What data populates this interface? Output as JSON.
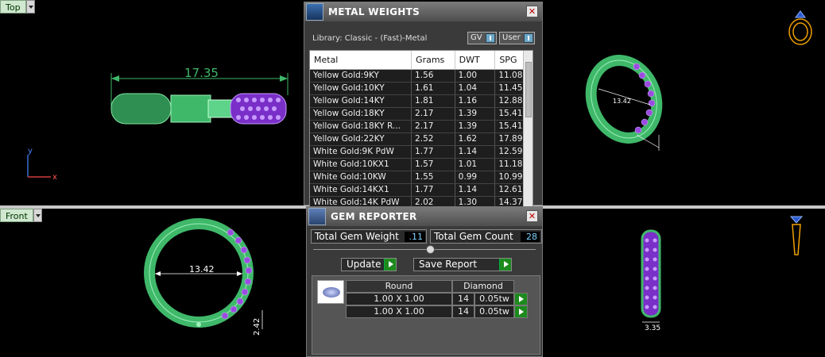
{
  "viewports": {
    "top": {
      "label": "Top",
      "dimension": "17.35"
    },
    "front": {
      "label": "Front",
      "dimension_width": "13.42",
      "dimension_height": "2.42"
    },
    "right_top": {
      "dimension": "13.42"
    },
    "right_bottom": {
      "dimension": "3.35"
    },
    "axis": {
      "y": "y",
      "x": "x"
    }
  },
  "metal_weights": {
    "title": "METAL WEIGHTS",
    "library": "Library: Classic - (Fast)-Metal",
    "toggle_gv": "GV",
    "toggle_user": "User",
    "columns": [
      "Metal",
      "Grams",
      "DWT",
      "SPG"
    ],
    "rows": [
      [
        "Yellow Gold:9KY",
        "1.56",
        "1.00",
        "11.08"
      ],
      [
        "Yellow Gold:10KY",
        "1.61",
        "1.04",
        "11.45"
      ],
      [
        "Yellow Gold:14KY",
        "1.81",
        "1.16",
        "12.88"
      ],
      [
        "Yellow Gold:18KY",
        "2.17",
        "1.39",
        "15.41"
      ],
      [
        "Yellow Gold:18KY R...",
        "2.17",
        "1.39",
        "15.41"
      ],
      [
        "Yellow Gold:22KY",
        "2.52",
        "1.62",
        "17.89"
      ],
      [
        "White Gold:9K PdW",
        "1.77",
        "1.14",
        "12.59"
      ],
      [
        "White Gold:10KX1",
        "1.57",
        "1.01",
        "11.18"
      ],
      [
        "White Gold:10KW",
        "1.55",
        "0.99",
        "10.99"
      ],
      [
        "White Gold:14KX1",
        "1.77",
        "1.14",
        "12.61"
      ],
      [
        "White Gold:14K PdW",
        "2.02",
        "1.30",
        "14.37"
      ]
    ]
  },
  "gem_reporter": {
    "title": "GEM REPORTER",
    "total_weight_label": "Total Gem Weight",
    "total_weight_value": ".11",
    "total_count_label": "Total Gem Count",
    "total_count_value": "28",
    "update_label": "Update",
    "save_label": "Save Report",
    "header": [
      "Round",
      "Diamond"
    ],
    "rows": [
      [
        "1.00 X 1.00",
        "14",
        "0.05tw"
      ],
      [
        "1.00 X 1.00",
        "14",
        "0.05tw"
      ]
    ]
  },
  "colors": {
    "ring_green": "#3fb86a",
    "gem_purple": "#9a4be0",
    "accent_gold": "#f0a000"
  }
}
